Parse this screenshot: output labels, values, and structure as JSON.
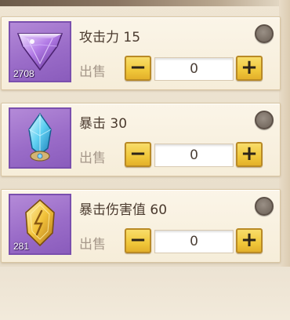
{
  "items": [
    {
      "name": "攻击力 15",
      "icon": "purple-gem-icon",
      "count": "2708",
      "sell_label": "出售",
      "minus_label": "−",
      "plus_label": "+",
      "quantity": "0",
      "thumb_color": "#9a6cc8"
    },
    {
      "name": "暴击 30",
      "icon": "blue-crystal-icon",
      "count": "",
      "sell_label": "出售",
      "minus_label": "−",
      "plus_label": "+",
      "quantity": "0",
      "thumb_color": "#9a6cc8"
    },
    {
      "name": "暴击伤害值 60",
      "icon": "gold-rune-crystal-icon",
      "count": "281",
      "sell_label": "出售",
      "minus_label": "−",
      "plus_label": "+",
      "quantity": "0",
      "thumb_color": "#9a6cc8"
    }
  ],
  "colors": {
    "button_yellow": "#f0c73a",
    "card_bg": "#f6edd9",
    "thumb_purple": "#9a6cc8"
  }
}
